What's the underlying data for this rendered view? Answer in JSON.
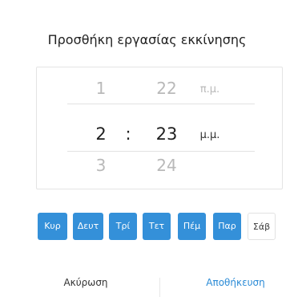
{
  "dialog": {
    "title": "Προσθήκη εργασίας εκκίνησης"
  },
  "picker": {
    "hour": {
      "prev": "1",
      "current": "2",
      "next": "3"
    },
    "separator": ":",
    "minute": {
      "prev": "22",
      "current": "23",
      "next": "24"
    },
    "ampm": {
      "prev": "π.μ.",
      "current": "μ.μ."
    }
  },
  "days": [
    {
      "label": "Κυρ",
      "selected": true
    },
    {
      "label": "Δευτ",
      "selected": true
    },
    {
      "label": "Τρί",
      "selected": true
    },
    {
      "label": "Τετ",
      "selected": true
    },
    {
      "label": "Πέμ",
      "selected": true
    },
    {
      "label": "Παρ",
      "selected": true
    },
    {
      "label": "Σάβ",
      "selected": false
    }
  ],
  "footer": {
    "cancel_label": "Ακύρωση",
    "save_label": "Αποθήκευση"
  },
  "colors": {
    "accent": "#3490d9",
    "save_text": "#2b8bd6"
  }
}
